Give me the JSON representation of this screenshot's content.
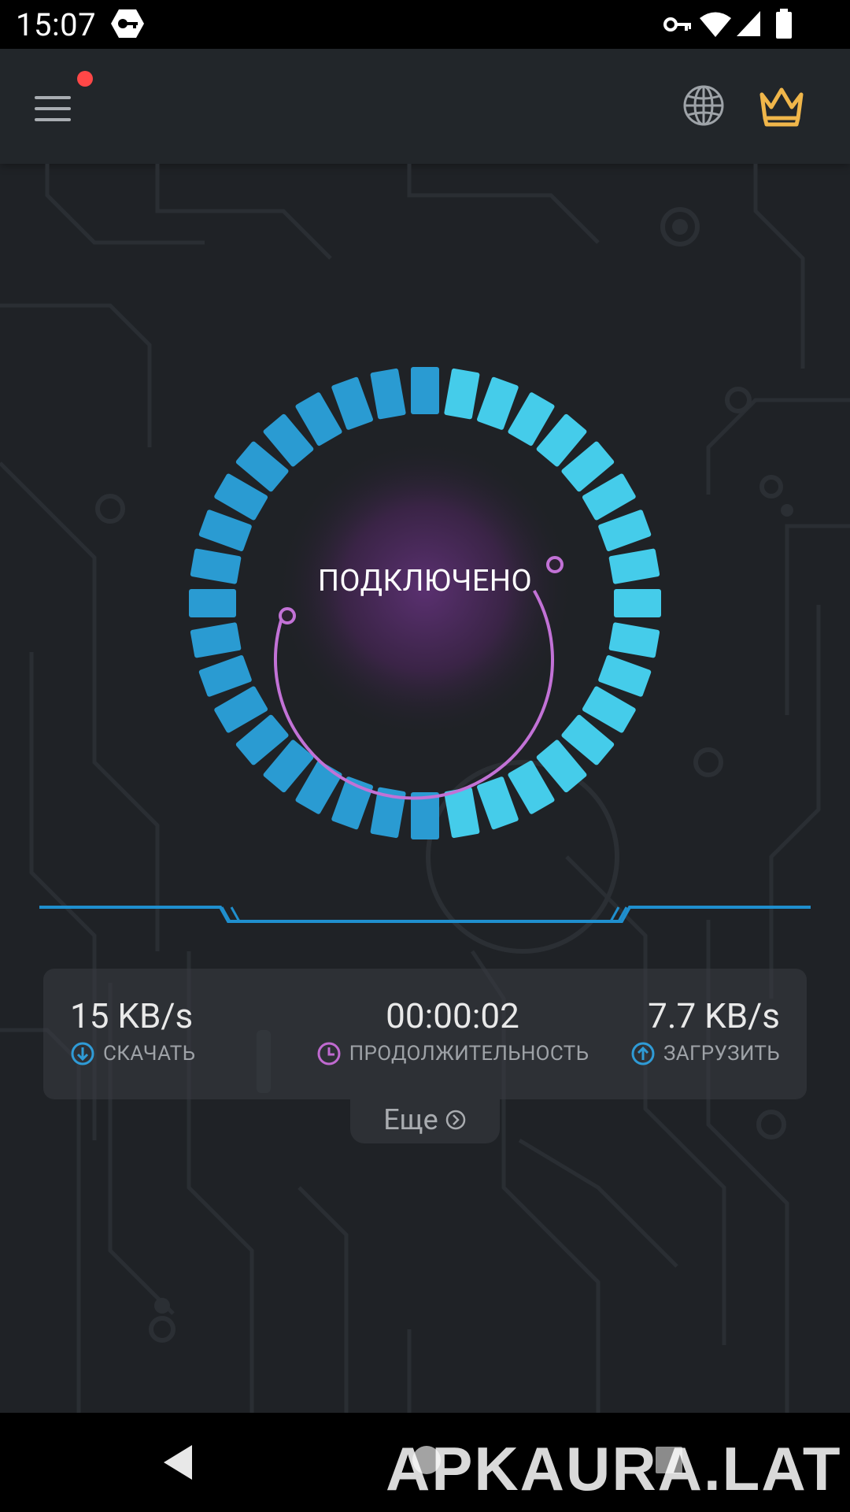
{
  "status_bar": {
    "time": "15:07"
  },
  "app_bar": {
    "menu_icon": "hamburger-menu-icon",
    "notification_color": "#ff4747",
    "globe_icon": "globe-icon",
    "premium_icon": "crown-icon",
    "premium_color": "#f0b64a"
  },
  "connection": {
    "status": "ПОДКЛЮЧЕНО",
    "ring_color": "#39b6e4",
    "arc_color": "#c272d6"
  },
  "stats": {
    "download": {
      "value": "15 KB/s",
      "label": "СКАЧАТЬ",
      "icon": "arrow-down-circle-icon",
      "icon_color": "#2f9bd6"
    },
    "duration": {
      "value": "00:00:02",
      "label": "ПРОДОЛЖИТЕЛЬНОСТЬ",
      "icon": "clock-icon",
      "icon_color": "#c06ad0"
    },
    "upload": {
      "value": "7.7 KB/s",
      "label": "ЗАГРУЗИТЬ",
      "icon": "arrow-up-circle-icon",
      "icon_color": "#2f9bd6"
    }
  },
  "more": {
    "label": "Еще"
  },
  "watermark": "APKAURA.LAT"
}
